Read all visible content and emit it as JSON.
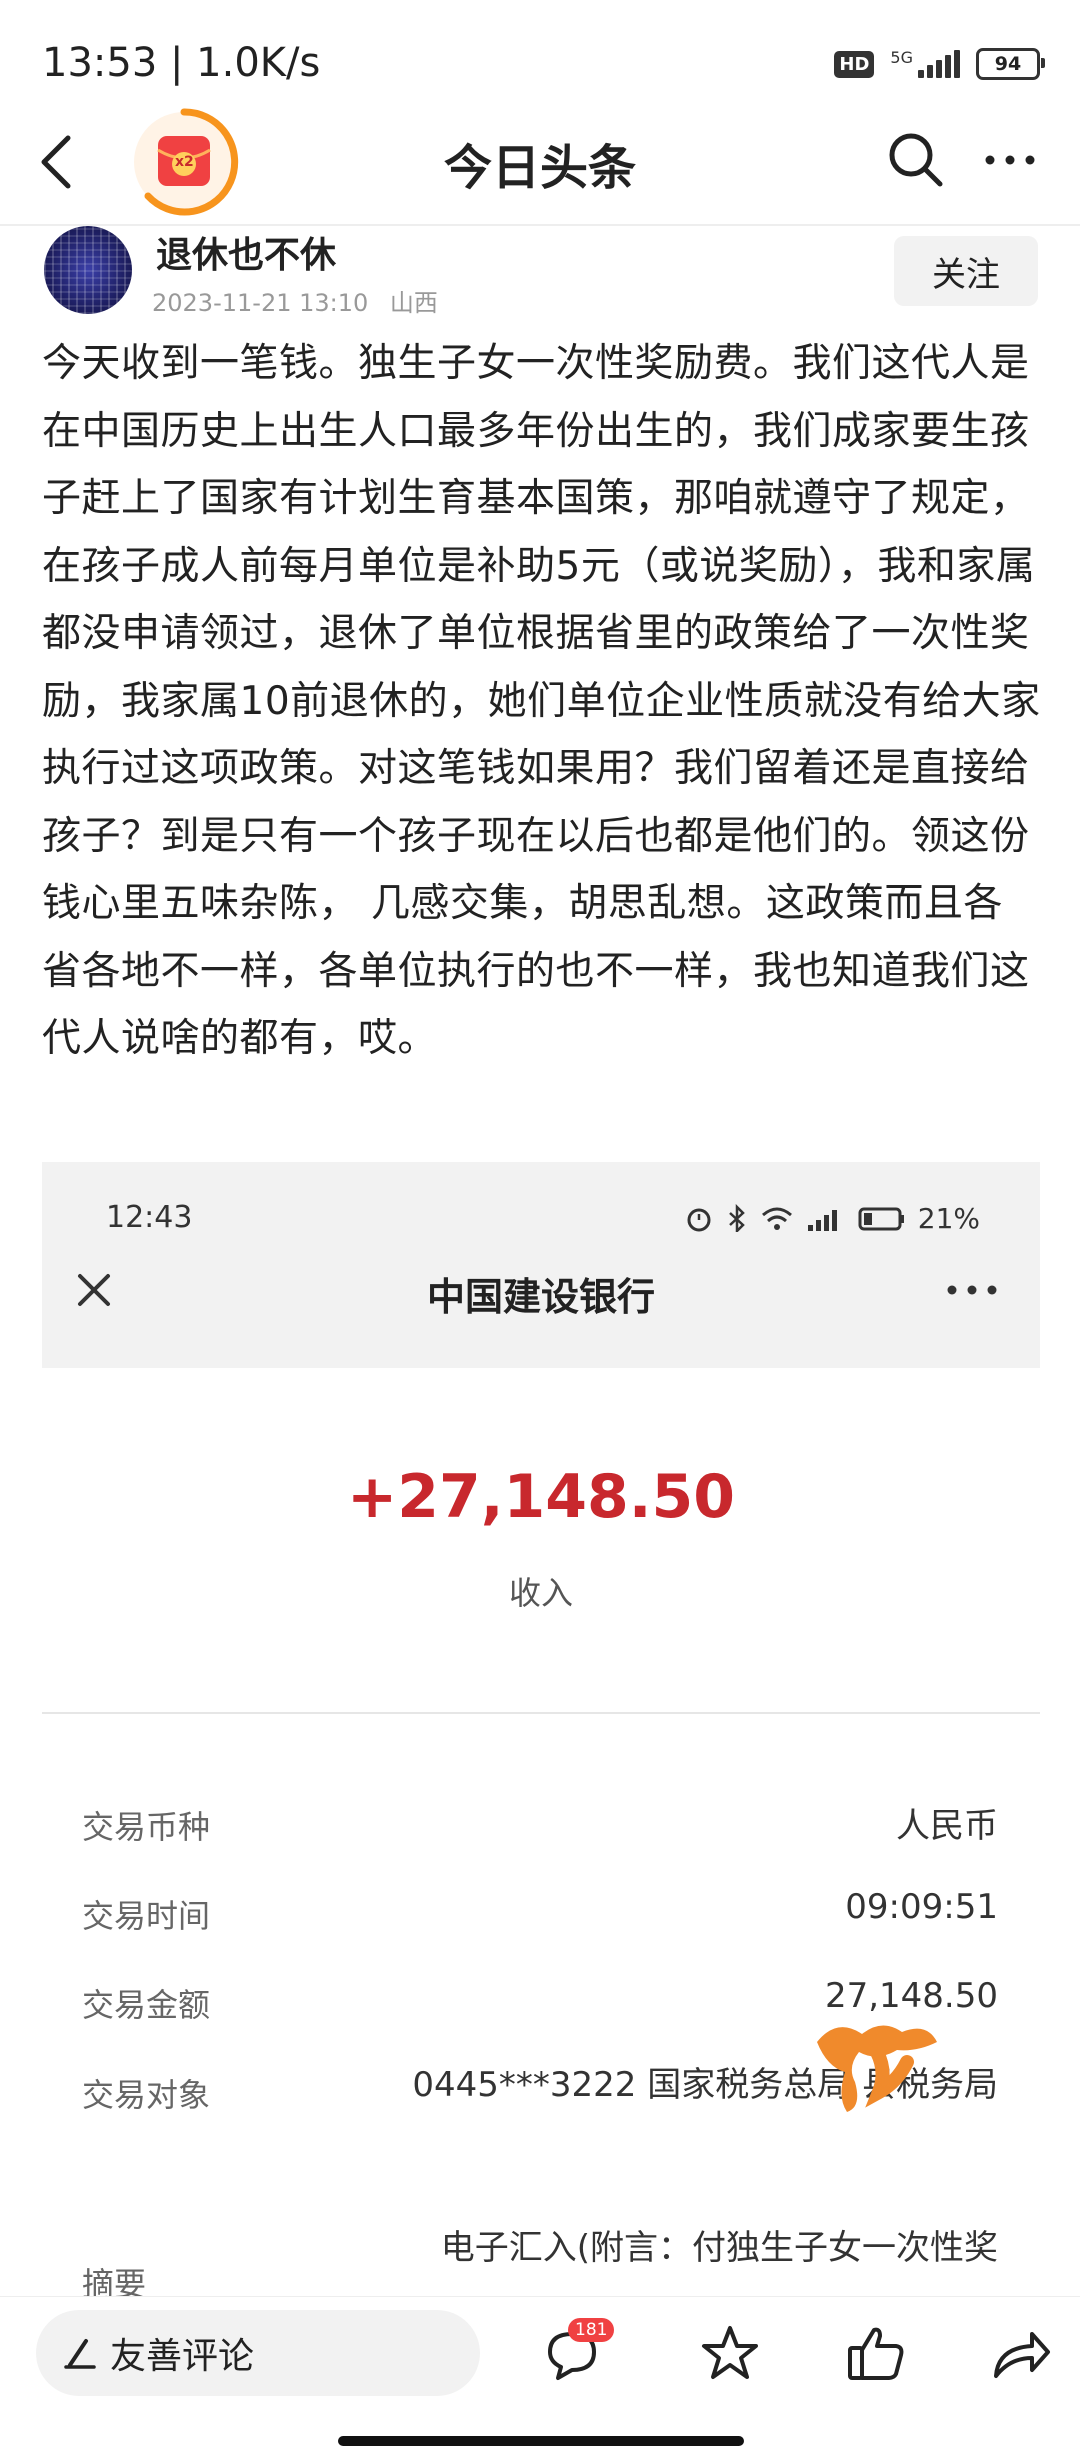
{
  "status_bar": {
    "time": "13:53 | 1.0K/s",
    "hd": "HD",
    "network": "5G",
    "battery": "94"
  },
  "nav": {
    "title": "今日头条",
    "badge_text": "x2"
  },
  "author": {
    "name": "退休也不休",
    "datetime": "2023-11-21 13:10",
    "location": "山西",
    "follow_label": "关注"
  },
  "article": {
    "body": "今天收到一笔钱。独生子女一次性奖励费。我们这代人是在中国历史上出生人口最多年份出生的，我们成家要生孩子赶上了国家有计划生育基本国策，那咱就遵守了规定，在孩子成人前每月单位是补助5元（或说奖励），我和家属都没申请领过，退休了单位根据省里的政策给了一次性奖励，我家属10前退休的，她们单位企业性质就没有给大家执行过这项政策。对这笔钱如果用？我们留着还是直接给孩子？到是只有一个孩子现在以后也都是他们的。领这份钱心里五味杂陈， 几感交集，胡思乱想。这政策而且各省各地不一样，各单位执行的也不一样，我也知道我们这代人说啥的都有，哎。"
  },
  "screenshot": {
    "status_time": "12:43",
    "battery": "21%",
    "title": "中国建设银行",
    "amount": "+27,148.50",
    "amount_label": "收入",
    "details": [
      {
        "label": "交易币种",
        "value": "人民币"
      },
      {
        "label": "交易时间",
        "value": "09:09:51"
      },
      {
        "label": "交易金额",
        "value": "27,148.50"
      },
      {
        "label": "交易对象",
        "value": "0445***3222 国家税务总局 县税务局"
      },
      {
        "label": "摘要",
        "value": "电子汇入(附言：付独生子女一次性奖"
      }
    ]
  },
  "bottom_bar": {
    "comment_placeholder": "友善评论",
    "comment_count": "181"
  },
  "colors": {
    "amount": "#c8282d",
    "badge_red": "#f04142",
    "scribble": "#f08a2c"
  }
}
